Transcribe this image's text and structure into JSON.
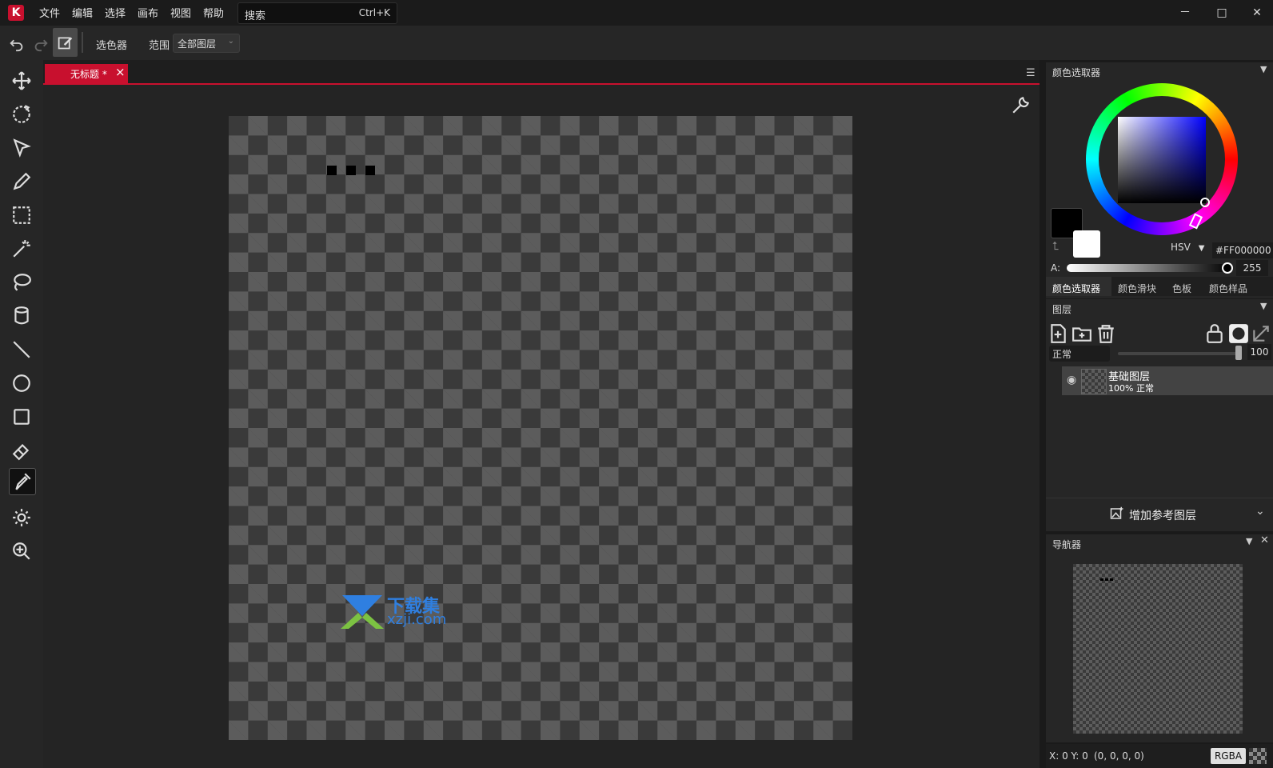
{
  "menu": {
    "items": [
      "文件",
      "编辑",
      "选择",
      "画布",
      "视图",
      "帮助"
    ],
    "search_label": "搜索",
    "search_shortcut": "Ctrl+K"
  },
  "window_controls": {
    "minimize": "－",
    "maximize": "□",
    "close": "✕"
  },
  "options_bar": {
    "tool_name": "选色器",
    "range_label": "范围",
    "range_value": "全部图层"
  },
  "toolbar": {
    "tools": [
      "move-icon",
      "rotate-icon",
      "select-arrow-icon",
      "pencil-icon",
      "rect-select-icon",
      "magic-wand-icon",
      "lasso-icon",
      "bucket-icon",
      "line-icon",
      "ellipse-icon",
      "rectangle-icon",
      "eraser-icon",
      "eyedropper-icon",
      "brightness-icon",
      "zoom-icon"
    ],
    "active_tool": "eyedropper-icon"
  },
  "document": {
    "tab_title": "无标题 *",
    "tab_close": "×"
  },
  "watermark": {
    "name": "下载集",
    "url": "xzji.com"
  },
  "color_panel": {
    "title": "颜色选取器",
    "mode": "HSV",
    "hex": "#FF000000",
    "alpha_label": "A:",
    "alpha_value": "255",
    "tabs": [
      "颜色选取器",
      "颜色滑块",
      "色板",
      "颜色样品"
    ],
    "primary_color": "#000000",
    "secondary_color": "#FFFFFF"
  },
  "layer_panel": {
    "title": "图层",
    "blend_mode": "正常",
    "opacity": "100",
    "layer_name": "基础图层",
    "layer_opacity": "100%",
    "layer_blend": "正常",
    "add_reference_label": "增加参考图层"
  },
  "navigator": {
    "title": "导航器",
    "coords": "X: 0 Y: 0",
    "pixel_value": "(0, 0, 0, 0)",
    "format": "RGBA"
  },
  "colors": {
    "accent": "#c8102e",
    "background": "#1e1e1e",
    "panel": "#262626"
  }
}
